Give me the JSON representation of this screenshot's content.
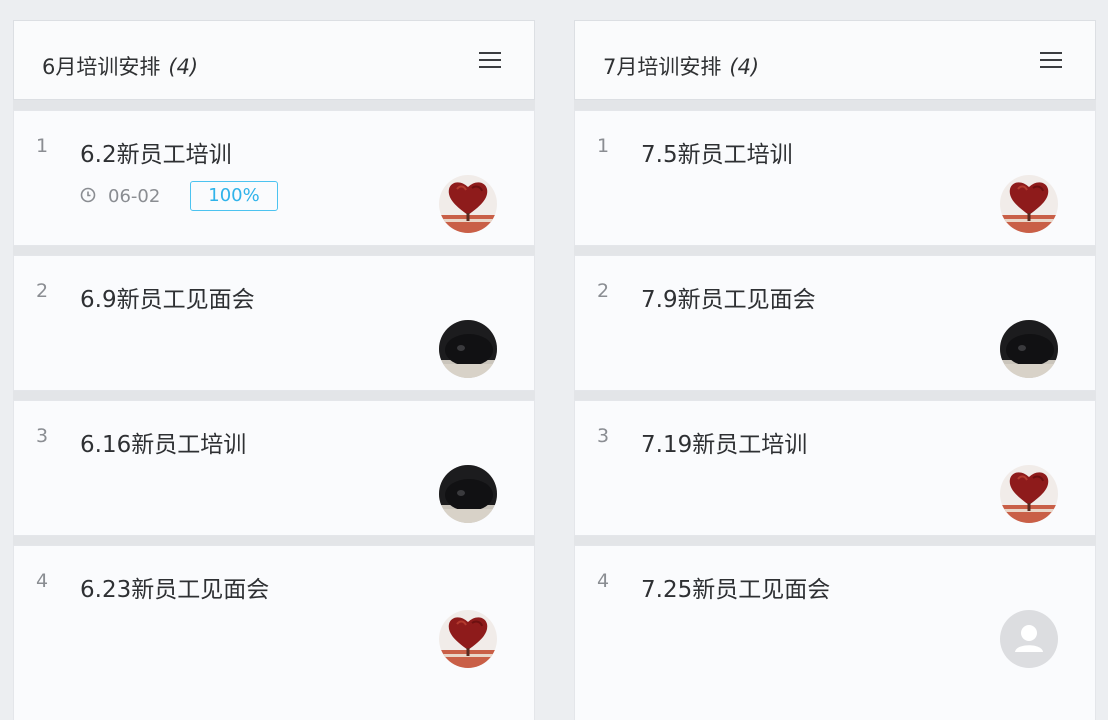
{
  "columns": [
    {
      "title": "6月培训安排",
      "count": "(4)",
      "menu_icon": "hamburger-menu-icon",
      "cards": [
        {
          "index": "1",
          "title": "6.2新员工培训",
          "date": "06-02",
          "progress": "100%",
          "progress_color": "#2fb3ea",
          "avatar": "heart"
        },
        {
          "index": "2",
          "title": "6.9新员工见面会",
          "avatar": "dark"
        },
        {
          "index": "3",
          "title": "6.16新员工培训",
          "avatar": "dark"
        },
        {
          "index": "4",
          "title": "6.23新员工见面会",
          "avatar": "heart"
        }
      ]
    },
    {
      "title": "7月培训安排",
      "count": "(4)",
      "menu_icon": "hamburger-menu-icon",
      "cards": [
        {
          "index": "1",
          "title": "7.5新员工培训",
          "avatar": "heart"
        },
        {
          "index": "2",
          "title": "7.9新员工见面会",
          "avatar": "dark"
        },
        {
          "index": "3",
          "title": "7.19新员工培训",
          "avatar": "heart"
        },
        {
          "index": "4",
          "title": "7.25新员工见面会",
          "avatar": "placeholder"
        }
      ]
    }
  ]
}
